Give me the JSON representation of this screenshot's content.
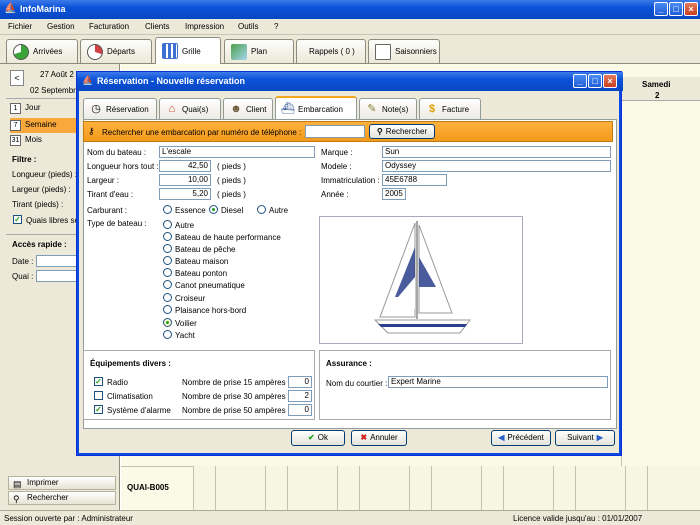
{
  "app": {
    "title": "InfoMarina",
    "menu": [
      "Fichier",
      "Gestion",
      "Facturation",
      "Clients",
      "Impression",
      "Outils",
      "?"
    ],
    "tabs": [
      {
        "label": "Arrivées",
        "color": "#3aa43a"
      },
      {
        "label": "Départs",
        "color": "#d24141"
      },
      {
        "label": "Grille",
        "color": "#3f6fd0"
      },
      {
        "label": "Plan",
        "color": "#4aa14a"
      },
      {
        "label": "Rappels ( 0 )",
        "color": "#ffffff"
      },
      {
        "label": "Saisonniers",
        "color": "#888888"
      }
    ],
    "active_tab": "Grille"
  },
  "sidebar": {
    "date_top": "27 Août 2",
    "date_bottom": "02 Septembr",
    "nav_prev": "<",
    "views": [
      {
        "num": "1",
        "label": "Jour"
      },
      {
        "num": "7",
        "label": "Semaine"
      },
      {
        "num": "31",
        "label": "Mois"
      }
    ],
    "active_view": "Semaine",
    "filter_title": "Filtre :",
    "filter_fields": [
      "Longueur (pieds) :",
      "Largeur (pieds) :",
      "Tirant (pieds) :"
    ],
    "free_quays_label": "Quais libres se",
    "quick_access_title": "Accès rapide :",
    "date_label": "Date :",
    "quai_label": "Quai :",
    "print_label": "Imprimer",
    "search_label": "Rechercher"
  },
  "grid": {
    "day_header": "Samedi",
    "day_num": "2",
    "row_label": "QUAI-B005"
  },
  "dialog": {
    "title": "Réservation - Nouvelle réservation",
    "tabs": [
      {
        "label": "Réservation",
        "icon": "clock-icon"
      },
      {
        "label": "Quai(s)",
        "icon": "house-icon"
      },
      {
        "label": "Client",
        "icon": "person-icon"
      },
      {
        "label": "Embarcation",
        "icon": "boat-icon"
      },
      {
        "label": "Note(s)",
        "icon": "note-icon"
      },
      {
        "label": "Facture",
        "icon": "dollar-icon"
      }
    ],
    "active_tab": "Embarcation",
    "search": {
      "label": "Rechercher une embarcation par numéro de téléphone :",
      "value": "",
      "button": "Rechercher"
    },
    "boat": {
      "name_label": "Nom du bateau :",
      "name": "L'escale",
      "length_label": "Longueur hors tout :",
      "length": "42,50",
      "width_label": "Largeur :",
      "width": "10,00",
      "draft_label": "Tirant d'eau :",
      "draft": "5,20",
      "unit": "( pieds )",
      "brand_label": "Marque :",
      "brand": "Sun",
      "model_label": "Modele :",
      "model": "Odyssey",
      "registration_label": "Immatriculation :",
      "registration": "45E6788",
      "year_label": "Année :",
      "year": "2005"
    },
    "fuel": {
      "label": "Carburant :",
      "options": [
        "Essence",
        "Diesel",
        "Autre"
      ],
      "selected": "Diesel"
    },
    "boat_type": {
      "label": "Type de bateau :",
      "options": [
        "Autre",
        "Bateau de haute performance",
        "Bateau de pêche",
        "Bateau maison",
        "Bateau ponton",
        "Canot pneumatique",
        "Croiseur",
        "Plaisance hors-bord",
        "Voilier",
        "Yacht"
      ],
      "selected": "Voilier"
    },
    "equipment": {
      "title": "Équipements divers :",
      "items": [
        {
          "label": "Radio",
          "checked": true
        },
        {
          "label": "Climatisation",
          "checked": false
        },
        {
          "label": "Système d'alarme",
          "checked": true
        }
      ],
      "plugs": [
        {
          "label": "Nombre de prise 15 ampères :",
          "value": "0"
        },
        {
          "label": "Nombre de prise 30 ampères :",
          "value": "2"
        },
        {
          "label": "Nombre de prise 50 ampères :",
          "value": "0"
        }
      ]
    },
    "insurance": {
      "title": "Assurance :",
      "broker_label": "Nom du courtier :",
      "broker": "Expert Marine"
    },
    "buttons": {
      "ok": "Ok",
      "cancel": "Annuler",
      "previous": "Précédent",
      "next": "Suivant"
    }
  },
  "status": {
    "session": "Session ouverte par : Administrateur",
    "license": "Licence valide jusqu'au : 01/01/2007"
  }
}
